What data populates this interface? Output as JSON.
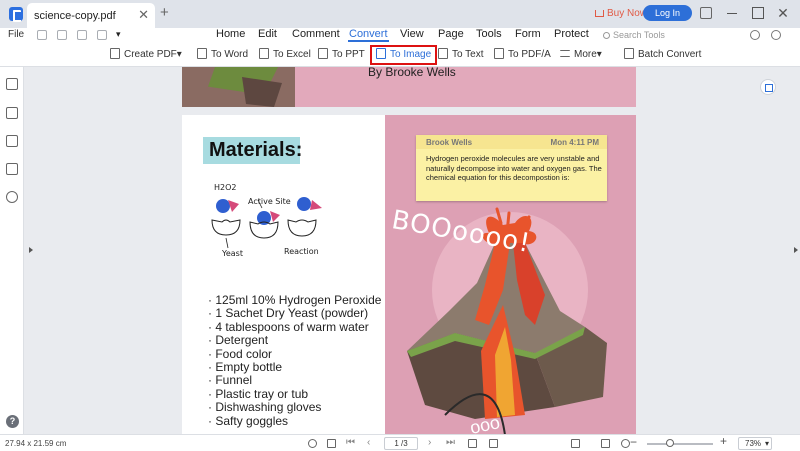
{
  "titlebar": {
    "tab_name": "science-copy.pdf",
    "close_glyph": "✕",
    "new_tab_glyph": "+",
    "buy_now": "Buy Now",
    "login": "Log In",
    "window_close_glyph": "✕"
  },
  "menubar": {
    "file": "File",
    "items": [
      "Home",
      "Edit",
      "Comment",
      "Convert",
      "View",
      "Page",
      "Tools",
      "Form",
      "Protect"
    ],
    "active": "Convert",
    "search_placeholder": "Search Tools"
  },
  "toolbar": {
    "create_pdf": "Create PDF",
    "to_word": "To Word",
    "to_excel": "To Excel",
    "to_ppt": "To PPT",
    "to_image": "To Image",
    "to_text": "To Text",
    "to_pdfa": "To PDF/A",
    "more": "More",
    "batch_convert": "Batch Convert",
    "dropdown_glyph": "▾"
  },
  "document": {
    "byline": "By Brooke Wells",
    "materials_title": "Materials:",
    "diagram_labels": {
      "h2o2": "H2O2",
      "active_site": "Active Site",
      "yeast": "Yeast",
      "reaction": "Reaction"
    },
    "materials": [
      "125ml 10% Hydrogen Peroxide",
      "1 Sachet Dry Yeast (powder)",
      "4 tablespoons of warm water",
      "Detergent",
      "Food color",
      "Empty bottle",
      "Funnel",
      "Plastic tray or tub",
      "Dishwashing gloves",
      "Safty goggles"
    ],
    "boom_text": "BOOoooo!",
    "boom_text_2": "ooo",
    "note": {
      "author": "Brook Wells",
      "time": "Mon 4:11 PM",
      "body": "Hydrogen peroxide molecules are very unstable and naturally decompose into water and oxygen gas. The chemical equation for this decompostion is:"
    }
  },
  "statusbar": {
    "dimensions": "27.94 x 21.59 cm",
    "page_indicator": "1 /3",
    "zoom": "73%",
    "zoom_out_glyph": "−",
    "zoom_in_glyph": "+",
    "first_glyph": "⏮",
    "prev_glyph": "‹",
    "next_glyph": "›",
    "last_glyph": "⏭"
  },
  "help_glyph": "?",
  "colors": {
    "accent": "#2d6fd8",
    "highlight_box": "#dd1111",
    "page_pink": "#dda0b4",
    "materials_bg": "#a7dbe0",
    "note_bg": "#fbf1a4"
  }
}
